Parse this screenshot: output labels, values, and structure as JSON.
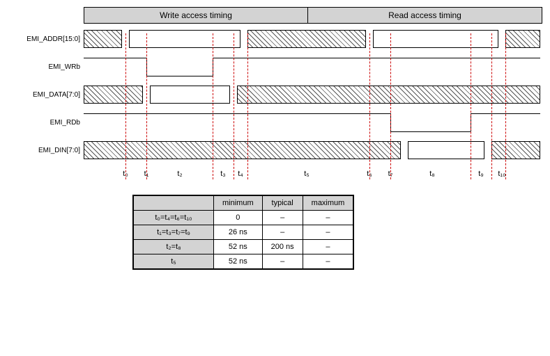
{
  "header": {
    "write_label": "Write access timing",
    "read_label": "Read access timing"
  },
  "signals": {
    "addr": "EMI_ADDR[15:0]",
    "wrb": "EMI_WRb",
    "data": "EMI_DATA[7:0]",
    "rdb": "EMI_RDb",
    "din": "EMI_DIN[7:0]"
  },
  "ticks": {
    "t0": "t₀",
    "t1": "t₁",
    "t2": "t₂",
    "t3": "t₃",
    "t4": "t₄",
    "t5": "t₅",
    "t6": "t₆",
    "t7": "t₇",
    "t8": "t₈",
    "t9": "t₉",
    "t10": "t₁₀"
  },
  "table": {
    "cols": {
      "min": "minimum",
      "typ": "typical",
      "max": "maximum"
    },
    "rows": [
      {
        "label": "t₀=t₄=t₆=t₁₀",
        "min": "0",
        "typ": "–",
        "max": "–"
      },
      {
        "label": "t₁=t₃=t₇=t₉",
        "min": "26 ns",
        "typ": "–",
        "max": "–"
      },
      {
        "label": "t₂=t₈",
        "min": "52 ns",
        "typ": "200 ns",
        "max": "–"
      },
      {
        "label": "t₅",
        "min": "52 ns",
        "typ": "–",
        "max": "–"
      }
    ]
  },
  "positions": {
    "t0": 60,
    "t1": 90,
    "t2a": 90,
    "t2b": 185,
    "t3": 215,
    "t4": 235,
    "t6": 410,
    "t7": 440,
    "t8a": 440,
    "t8b": 555,
    "t9": 585,
    "t10": 605,
    "end": 655,
    "hdr_split": 320
  }
}
